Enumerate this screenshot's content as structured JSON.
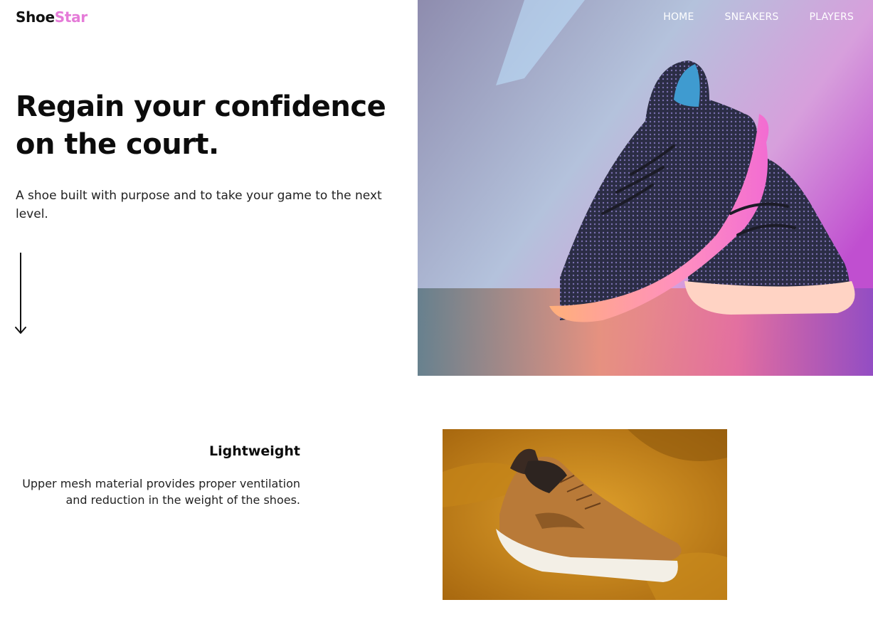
{
  "brand": {
    "part1": "Shoe",
    "part2": "Star",
    "accent": "#e57bd8"
  },
  "nav": {
    "items": [
      "HOME",
      "SNEAKERS",
      "PLAYERS"
    ]
  },
  "hero": {
    "headline": "Regain your confidence on the court.",
    "subtext": "A shoe built with purpose and to take your game to the next level.",
    "image_icon": "sneaker-photo-icon",
    "scroll_icon": "arrow-down-icon"
  },
  "feature": {
    "title": "Lightweight",
    "description": "Upper mesh material provides proper ventilation and reduction in the weight of the shoes.",
    "image_icon": "sneaker-photo-icon"
  }
}
